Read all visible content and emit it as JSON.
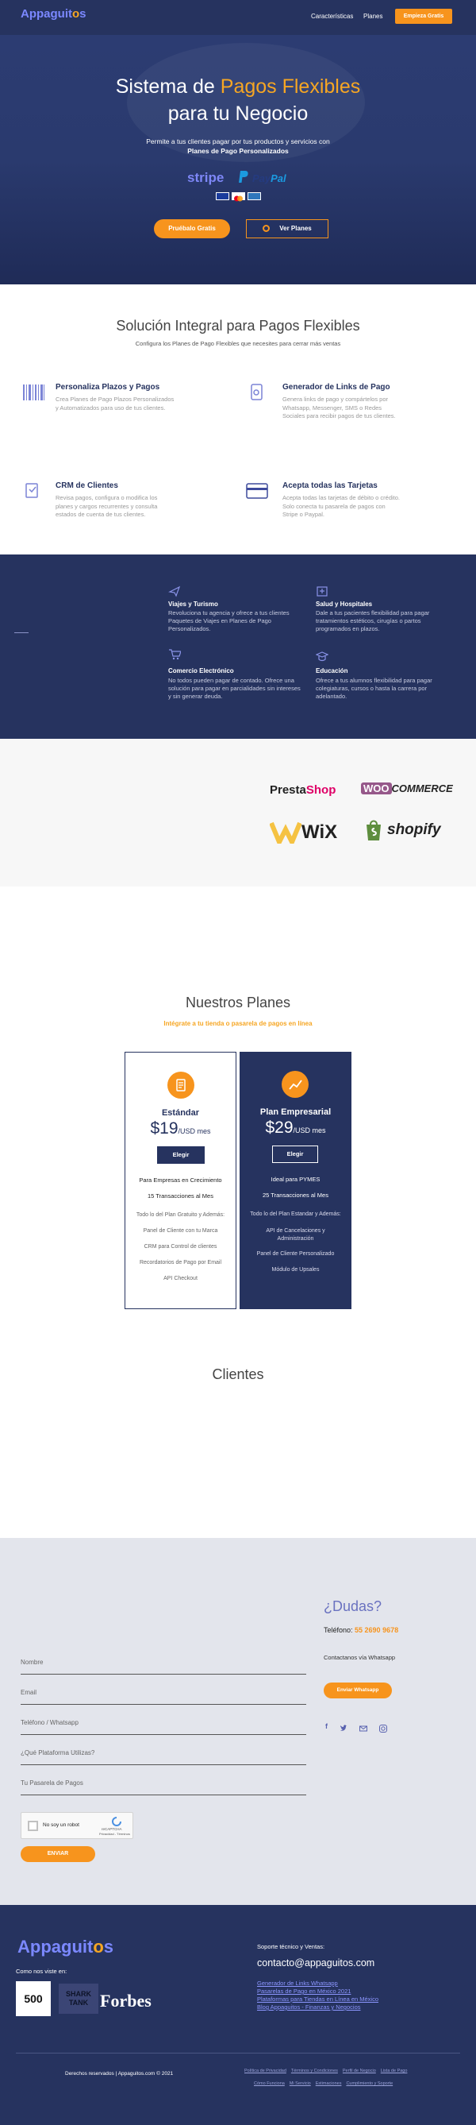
{
  "header": {
    "logo": "Appaguit",
    "logo_o": "o",
    "logo_s": "s",
    "nav": [
      "Características",
      "Planes"
    ],
    "cta": "Empieza Gratis"
  },
  "hero": {
    "title_1": "Sistema de ",
    "title_hl": "Pagos Flexibles",
    "title_2": "para tu Negocio",
    "subtitle": "Permite a tus clientes pagar por tus productos y servicios con",
    "subtitle_bold": "Planes de Pago Personalizados",
    "stripe": "stripe",
    "paypal_a": "Pay",
    "paypal_b": "Pal",
    "btn_primary": "Pruébalo Gratis",
    "btn_secondary": "Ver Planes"
  },
  "solution": {
    "title": "Solución Integral para Pagos Flexibles",
    "subtitle": "Configura los Planes de Pago Flexibles que necesites para cerrar más ventas",
    "features": [
      {
        "title": "Personaliza Plazos y Pagos",
        "desc": "Crea Planes de Pago Plazos Personalizados y Automatizados para uso de tus clientes."
      },
      {
        "title": "Generador de Links de Pago",
        "desc": "Genera links de pago y compártelos por Whatsapp, Messenger, SMS o Redes Sociales para recibir pagos de tus clientes."
      },
      {
        "title": "CRM de Clientes",
        "desc": "Revisa pagos, configura o modifica los planes y cargos recurrentes y consulta estados de cuenta de tus clientes."
      },
      {
        "title": "Acepta todas las Tarjetas",
        "desc": "Acepta todas las tarjetas de débito o crédito. Solo conecta tu pasarela de pagos con Stripe o Paypal."
      }
    ]
  },
  "industries": [
    {
      "title": "Viajes y Turismo",
      "desc": "Revoluciona tu agencia y ofrece a tus clientes Paquetes de Viajes en Planes de Pago Personalizados."
    },
    {
      "title": "Salud y Hospitales",
      "desc": "Dale a tus pacientes flexibilidad para pagar tratamientos estéticos, cirugías o partos programados en plazos."
    },
    {
      "title": "Comercio Electrónico",
      "desc": "No todos pueden pagar de contado. Ofrece una solución para pagar en parcialidades sin intereses y sin generar deuda."
    },
    {
      "title": "Educación",
      "desc": "Ofrece a tus alumnos flexibilidad para pagar colegiaturas, cursos o hasta la carrera por adelantado."
    }
  ],
  "platforms": {
    "presta_1": "Presta",
    "presta_2": "Shop",
    "woo_1": "WOO",
    "woo_2": "COMMERCE",
    "wix": "WiX",
    "shopify": "shopify"
  },
  "plans": {
    "title": "Nuestros Planes",
    "subtitle": "Intégrate a tu tienda o pasarela de pagos en línea",
    "cards": [
      {
        "name": "Estándar",
        "price": "$19",
        "period": "/USD mes",
        "button": "Elegir",
        "highlights": [
          "Para Empresas en Crecimiento",
          "15 Transacciones al Mes"
        ],
        "items": [
          "Todo lo del Plan Gratuito y Además:",
          "Panel de Cliente con tu Marca",
          "CRM para Control de clientes",
          "Recordatorios de Pago por Email",
          "API Checkout"
        ]
      },
      {
        "name": "Plan Empresarial",
        "price": "$29",
        "period": "/USD mes",
        "button": "Elegir",
        "highlights": [
          "Ideal para PYMES",
          "25 Transacciones al Mes"
        ],
        "items": [
          "Todo lo del Plan Estandar y Además:",
          "API de Cancelaciones y Administración",
          "Panel de Cliente Personalizado",
          "Módulo de Upsales"
        ]
      }
    ]
  },
  "clients": {
    "title": "Clientes"
  },
  "contact": {
    "fields": [
      "Nombre",
      "Email",
      "Teléfono / Whatsapp",
      "¿Qué Plataforma Utilizas?",
      "Tu Pasarela de Pagos"
    ],
    "captcha": "No soy un robot",
    "captcha_brand": "reCAPTCHA",
    "captcha_terms": "Privacidad - Términos",
    "submit": "ENVIAR",
    "doubts": "¿Dudas?",
    "phone_label": "Teléfono: ",
    "phone": "55 2690 9678",
    "whatsapp_text": "Contactanos vía Whatsapp",
    "whatsapp_btn": "Enviar Whatsapp"
  },
  "footer": {
    "seen_in": "Como nos viste en:",
    "logo_500": "500",
    "logo_shark": "SHARK TANK",
    "logo_forbes": "Forbes",
    "support_label": "Soporte técnico y Ventas:",
    "email": "contacto@appaguitos.com",
    "links": [
      "Generador de Links Whatsapp",
      "Pasarelas de Pago en México 2021",
      "Plataformas para Tiendas en Línea en México",
      "Blog Appaguitos - Finanzas y Negocios"
    ],
    "copyright": "Derechos reservados | Appaguitos.com © 2021",
    "legal_row1": [
      "Política de Privacidad",
      "Términos y Condiciones",
      "Perfil de Negocio",
      "Lista de Pago"
    ],
    "legal_row2": [
      "Cómo Funciona",
      "Mi Servicio",
      "Estimaciones",
      "Cumplimiento y Soporte"
    ]
  },
  "colors": {
    "navy": "#26335f",
    "orange": "#f7941d",
    "accent": "#f6a623",
    "link": "#8c96ff"
  }
}
